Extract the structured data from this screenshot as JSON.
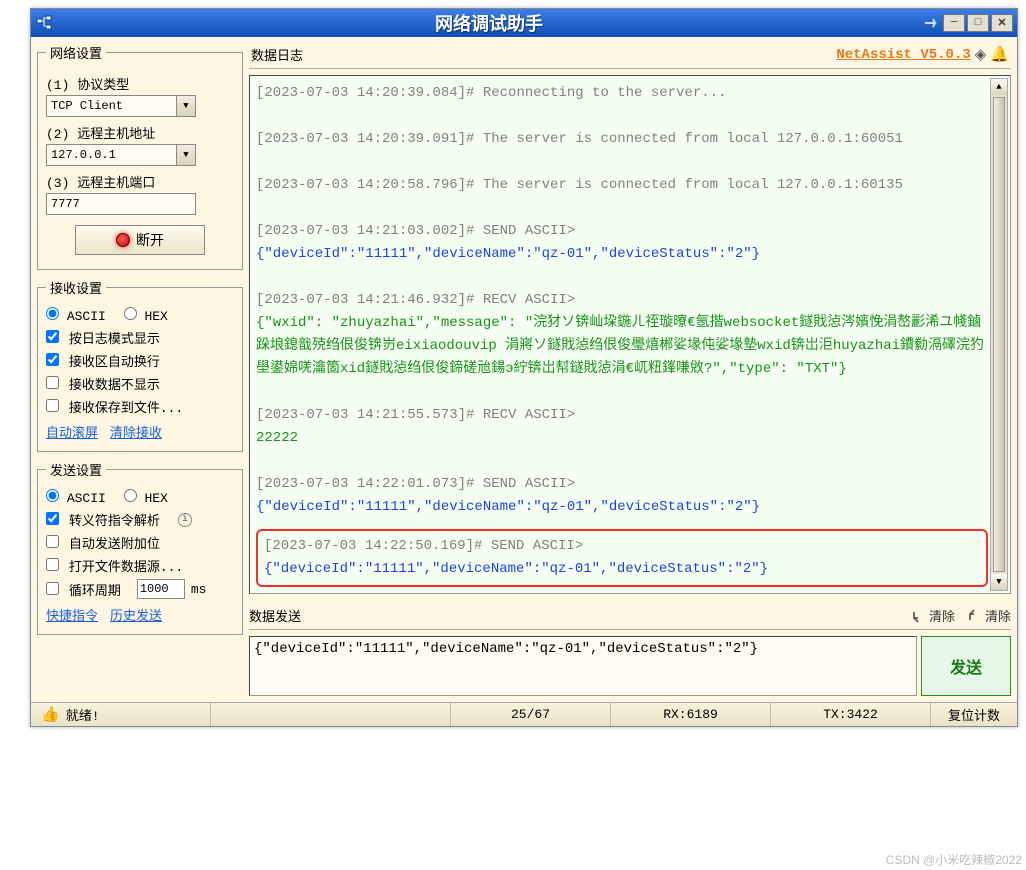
{
  "titlebar": {
    "title": "网络调试助手"
  },
  "brand": "NetAssist V5.0.3",
  "net": {
    "legend": "网络设置",
    "proto_label": "(1) 协议类型",
    "proto_value": "TCP Client",
    "host_label": "(2) 远程主机地址",
    "host_value": "127.0.0.1",
    "port_label": "(3) 远程主机端口",
    "port_value": "7777",
    "disconnect": "断开"
  },
  "recv": {
    "legend": "接收设置",
    "ascii": "ASCII",
    "hex": "HEX",
    "chk1": "按日志模式显示",
    "chk2": "接收区自动换行",
    "chk3": "接收数据不显示",
    "chk4": "接收保存到文件...",
    "link1": "自动滚屏",
    "link2": "清除接收"
  },
  "send": {
    "legend": "发送设置",
    "ascii": "ASCII",
    "hex": "HEX",
    "chk1": "转义符指令解析",
    "chk2": "自动发送附加位",
    "chk3": "打开文件数据源...",
    "chk4_pre": "循环周期",
    "chk4_val": "1000",
    "chk4_suf": "ms",
    "link1": "快捷指令",
    "link2": "历史发送"
  },
  "log_title": "数据日志",
  "log": {
    "l1t": "[2023-07-03 14:20:39.084]# Reconnecting to the server...",
    "l2t": "[2023-07-03 14:20:39.091]# The server is connected from local 127.0.0.1:60051",
    "l3t": "[2023-07-03 14:20:58.796]# The server is connected from local 127.0.0.1:60135",
    "l4t": "[2023-07-03 14:21:03.002]# SEND ASCII>",
    "l4d": "{\"deviceId\":\"11111\",\"deviceName\":\"qz-01\",\"deviceStatus\":\"2\"}",
    "l5t": "[2023-07-03 14:21:46.932]# RECV ASCII>",
    "l5d": "{\"wxid\": \"zhuyazhai\",\"message\": \"浣犲ソ锛屾垜鍦ㄦ祬璇曢€氬揩websocket鐩戝惉涔嬪悗涓嶅彲浠ユ帴鏀跺埌鎴戠殑绉佷俊锛岃eixiaodouvip 涓嶈ソ鐩戝惉绉佷俊璺熺郴娑堟伅娑堟墊wxid锛岀洰huyazhai鐨勬滆礋浣犳壆鍙婂唴瀹箇xid鐩戝惉绉佷俊鍗磋兘鍚э紵锛岀幇鐩戝惉涓€屼粈鎽嗛敓?\",\"type\": \"TXT\"}",
    "l6t": "[2023-07-03 14:21:55.573]# RECV ASCII>",
    "l6d": "22222",
    "l7t": "[2023-07-03 14:22:01.073]# SEND ASCII>",
    "l7d": "{\"deviceId\":\"11111\",\"deviceName\":\"qz-01\",\"deviceStatus\":\"2\"}",
    "l8t": "[2023-07-03 14:22:50.169]# SEND ASCII>",
    "l8d": "{\"deviceId\":\"11111\",\"deviceName\":\"qz-01\",\"deviceStatus\":\"2\"}"
  },
  "dsend": {
    "title": "数据发送",
    "clear1": "清除",
    "clear2": "清除",
    "input": "{\"deviceId\":\"11111\",\"deviceName\":\"qz-01\",\"deviceStatus\":\"2\"}",
    "btn": "发送"
  },
  "status": {
    "ready": "就绪!",
    "counts": "25/67",
    "rx": "RX:6189",
    "tx": "TX:3422",
    "reset": "复位计数"
  },
  "watermark": "CSDN @小米吃辣椒2022"
}
